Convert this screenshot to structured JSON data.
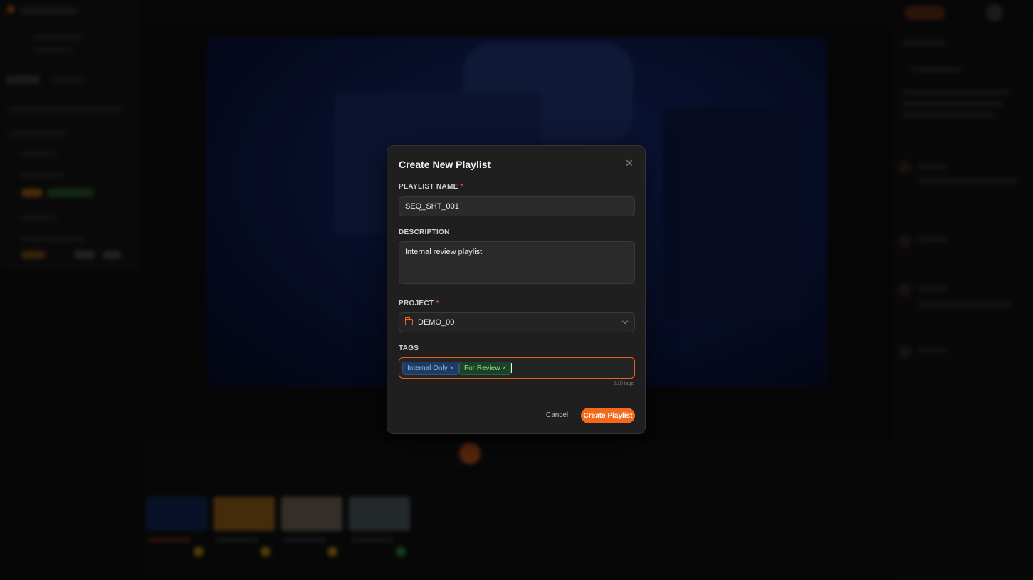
{
  "modal": {
    "title": "Create New Playlist",
    "close_icon": "close-icon",
    "playlist_name": {
      "label": "PLAYLIST NAME",
      "required_mark": "*",
      "value": "SEQ_SHT_001"
    },
    "description": {
      "label": "DESCRIPTION",
      "value": "Internal review playlist"
    },
    "project": {
      "label": "PROJECT",
      "required_mark": "*",
      "value": "DEMO_00",
      "icon": "folder-icon"
    },
    "tags": {
      "label": "TAGS",
      "items": [
        {
          "label": "Internal Only",
          "remove": "×",
          "color": "#8fb9f2"
        },
        {
          "label": "For Review",
          "remove": "×",
          "color": "#8fdca0"
        }
      ],
      "count_text": "2/10 tags"
    },
    "cancel_label": "Cancel",
    "create_label": "Create Playlist"
  },
  "colors": {
    "accent": "#f26a1b",
    "modal_bg": "#1f1f1f",
    "video_tint": "#0e2370"
  }
}
